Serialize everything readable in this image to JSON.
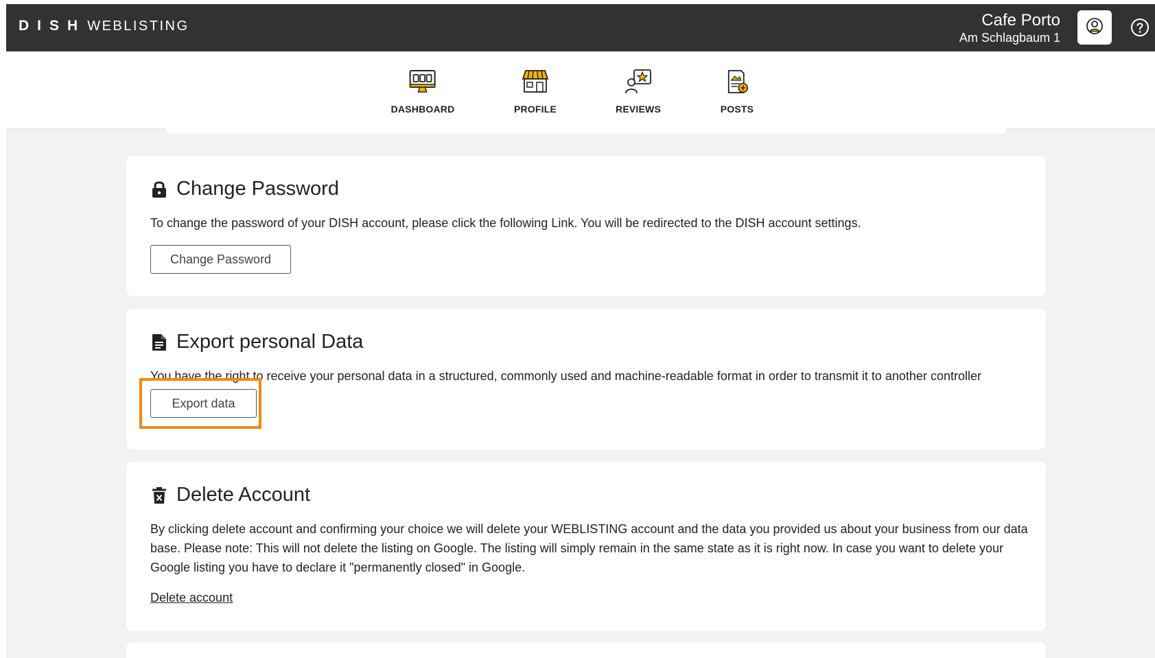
{
  "brand": {
    "dish": "DISH",
    "product": "WEBLISTING"
  },
  "venue": {
    "name": "Cafe Porto",
    "address": "Am Schlagbaum 1"
  },
  "header_icons": {
    "account": "account-circle-icon",
    "help": "help-icon"
  },
  "nav": {
    "items": [
      {
        "label": "DASHBOARD",
        "icon": "dashboard-monitor-icon"
      },
      {
        "label": "PROFILE",
        "icon": "storefront-icon"
      },
      {
        "label": "REVIEWS",
        "icon": "review-star-icon"
      },
      {
        "label": "POSTS",
        "icon": "post-add-icon"
      }
    ]
  },
  "change_password": {
    "title": "Change Password",
    "icon": "lock-icon",
    "description": "To change the password of your DISH account, please click the following Link. You will be redirected to the DISH account settings.",
    "button": "Change Password"
  },
  "export_data": {
    "title": "Export personal Data",
    "icon": "document-icon",
    "description": "You have the right to receive your personal data in a structured, commonly used and machine-readable format in order to transmit it to another controller",
    "button": "Export data",
    "highlight_color": "#f5890f"
  },
  "delete_account": {
    "title": "Delete Account",
    "icon": "trash-icon",
    "description": "By clicking delete account and confirming your choice we will delete your WEBLISTING account and the data you provided us about your business from our data base. Please note: This will not delete the listing on Google. The listing will simply remain in the same state as it is right now. In case you want to delete your Google listing you have to declare it \"permanently closed\" in Google.",
    "link": "Delete account"
  },
  "colors": {
    "topbar": "#323232",
    "page_bg": "#f2f2f2",
    "accent": "#f5b400"
  }
}
